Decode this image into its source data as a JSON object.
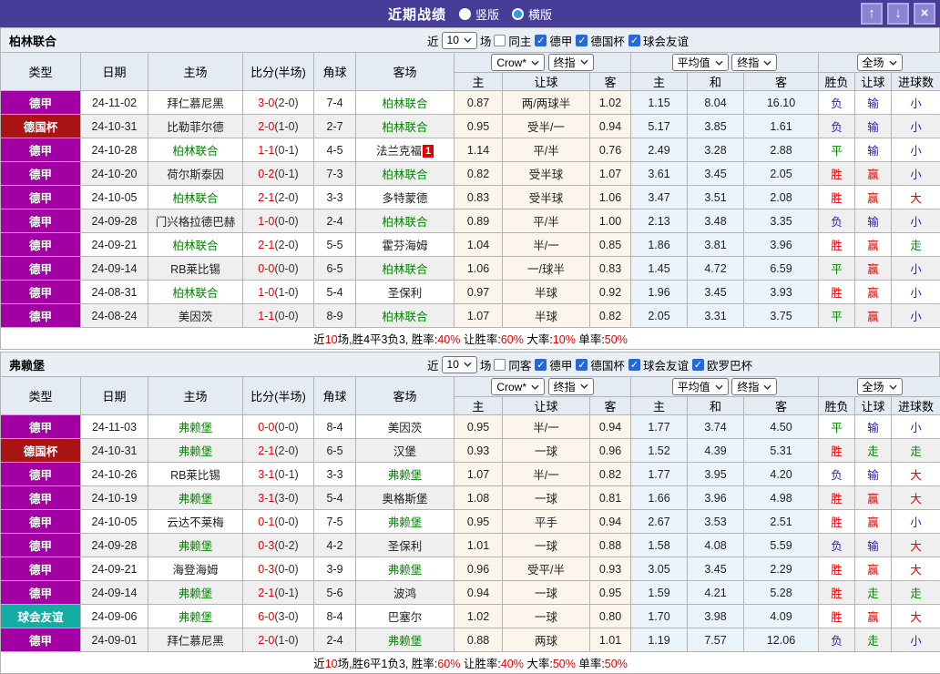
{
  "titlebar": {
    "title": "近期战绩",
    "vertical_label": "竖版",
    "horizontal_label": "横版",
    "selected": "横版",
    "buttons": {
      "up": "↑",
      "down": "↓",
      "close": "×"
    }
  },
  "labels": {
    "near": "近",
    "games": "场"
  },
  "selects": {
    "provider": "Crow*",
    "final1": "终指",
    "average": "平均值",
    "final2": "终指",
    "fulltime": "全场"
  },
  "columns": {
    "type": "类型",
    "date": "日期",
    "home": "主场",
    "score": "比分(半场)",
    "corner": "角球",
    "away": "客场",
    "h_home": "主",
    "h_line": "让球",
    "h_away": "客",
    "a_home": "主",
    "a_draw": "和",
    "a_away": "客",
    "res_wdl": "胜负",
    "res_handicap": "让球",
    "res_goals": "进球数"
  },
  "type_colors": {
    "德甲": "#A300A3",
    "德国杯": "#AA1414",
    "球会友谊": "#16ACA4"
  },
  "result_colors": {
    "win": "#E60000",
    "draw": "#008800",
    "lose": "#2222CC"
  },
  "tables": [
    {
      "team": "柏林联合",
      "filter": {
        "count": "10",
        "checks": [
          {
            "label": "同主",
            "checked": false
          },
          {
            "label": "德甲",
            "checked": true
          },
          {
            "label": "德国杯",
            "checked": true
          },
          {
            "label": "球会友谊",
            "checked": true
          }
        ]
      },
      "rows": [
        {
          "type": "德甲",
          "date": "24-11-02",
          "home": "拜仁慕尼黑",
          "home_green": false,
          "score": "3-0",
          "half": "(2-0)",
          "corners": "7-4",
          "away": "柏林联合",
          "away_green": true,
          "away_badge": "",
          "crow_home": "0.87",
          "crow_line": "两/两球半",
          "crow_away": "1.02",
          "avg_home": "1.15",
          "avg_draw": "8.04",
          "avg_away": "16.10",
          "result": "负",
          "handicap": "输",
          "goals": "小"
        },
        {
          "type": "德国杯",
          "date": "24-10-31",
          "home": "比勒菲尔德",
          "home_green": false,
          "score": "2-0",
          "half": "(1-0)",
          "corners": "2-7",
          "away": "柏林联合",
          "away_green": true,
          "away_badge": "",
          "crow_home": "0.95",
          "crow_line": "受半/一",
          "crow_away": "0.94",
          "avg_home": "5.17",
          "avg_draw": "3.85",
          "avg_away": "1.61",
          "result": "负",
          "handicap": "输",
          "goals": "小"
        },
        {
          "type": "德甲",
          "date": "24-10-28",
          "home": "柏林联合",
          "home_green": true,
          "score": "1-1",
          "half": "(0-1)",
          "corners": "4-5",
          "away": "法兰克福",
          "away_green": false,
          "away_badge": "1",
          "crow_home": "1.14",
          "crow_line": "平/半",
          "crow_away": "0.76",
          "avg_home": "2.49",
          "avg_draw": "3.28",
          "avg_away": "2.88",
          "result": "平",
          "handicap": "输",
          "goals": "小"
        },
        {
          "type": "德甲",
          "date": "24-10-20",
          "home": "荷尔斯泰因",
          "home_green": false,
          "score": "0-2",
          "half": "(0-1)",
          "corners": "7-3",
          "away": "柏林联合",
          "away_green": true,
          "away_badge": "",
          "crow_home": "0.82",
          "crow_line": "受半球",
          "crow_away": "1.07",
          "avg_home": "3.61",
          "avg_draw": "3.45",
          "avg_away": "2.05",
          "result": "胜",
          "handicap": "赢",
          "goals": "小"
        },
        {
          "type": "德甲",
          "date": "24-10-05",
          "home": "柏林联合",
          "home_green": true,
          "score": "2-1",
          "half": "(2-0)",
          "corners": "3-3",
          "away": "多特蒙德",
          "away_green": false,
          "away_badge": "",
          "crow_home": "0.83",
          "crow_line": "受半球",
          "crow_away": "1.06",
          "avg_home": "3.47",
          "avg_draw": "3.51",
          "avg_away": "2.08",
          "result": "胜",
          "handicap": "赢",
          "goals": "大"
        },
        {
          "type": "德甲",
          "date": "24-09-28",
          "home": "门兴格拉德巴赫",
          "home_green": false,
          "score": "1-0",
          "half": "(0-0)",
          "corners": "2-4",
          "away": "柏林联合",
          "away_green": true,
          "away_badge": "",
          "crow_home": "0.89",
          "crow_line": "平/半",
          "crow_away": "1.00",
          "avg_home": "2.13",
          "avg_draw": "3.48",
          "avg_away": "3.35",
          "result": "负",
          "handicap": "输",
          "goals": "小"
        },
        {
          "type": "德甲",
          "date": "24-09-21",
          "home": "柏林联合",
          "home_green": true,
          "score": "2-1",
          "half": "(2-0)",
          "corners": "5-5",
          "away": "霍芬海姆",
          "away_green": false,
          "away_badge": "",
          "crow_home": "1.04",
          "crow_line": "半/一",
          "crow_away": "0.85",
          "avg_home": "1.86",
          "avg_draw": "3.81",
          "avg_away": "3.96",
          "result": "胜",
          "handicap": "赢",
          "goals": "走"
        },
        {
          "type": "德甲",
          "date": "24-09-14",
          "home": "RB莱比锡",
          "home_green": false,
          "score": "0-0",
          "half": "(0-0)",
          "corners": "6-5",
          "away": "柏林联合",
          "away_green": true,
          "away_badge": "",
          "crow_home": "1.06",
          "crow_line": "一/球半",
          "crow_away": "0.83",
          "avg_home": "1.45",
          "avg_draw": "4.72",
          "avg_away": "6.59",
          "result": "平",
          "handicap": "赢",
          "goals": "小"
        },
        {
          "type": "德甲",
          "date": "24-08-31",
          "home": "柏林联合",
          "home_green": true,
          "score": "1-0",
          "half": "(1-0)",
          "corners": "5-4",
          "away": "圣保利",
          "away_green": false,
          "away_badge": "",
          "crow_home": "0.97",
          "crow_line": "半球",
          "crow_away": "0.92",
          "avg_home": "1.96",
          "avg_draw": "3.45",
          "avg_away": "3.93",
          "result": "胜",
          "handicap": "赢",
          "goals": "小"
        },
        {
          "type": "德甲",
          "date": "24-08-24",
          "home": "美因茨",
          "home_green": false,
          "score": "1-1",
          "half": "(0-0)",
          "corners": "8-9",
          "away": "柏林联合",
          "away_green": true,
          "away_badge": "",
          "crow_home": "1.07",
          "crow_line": "半球",
          "crow_away": "0.82",
          "avg_home": "2.05",
          "avg_draw": "3.31",
          "avg_away": "3.75",
          "result": "平",
          "handicap": "赢",
          "goals": "小"
        }
      ],
      "summary": [
        {
          "t": "近",
          "red": false
        },
        {
          "t": "10",
          "red": true
        },
        {
          "t": "场,胜4平3负3, 胜率:",
          "red": false
        },
        {
          "t": "40%",
          "red": true
        },
        {
          "t": " 让胜率:",
          "red": false
        },
        {
          "t": "60%",
          "red": true
        },
        {
          "t": " 大率:",
          "red": false
        },
        {
          "t": "10%",
          "red": true
        },
        {
          "t": " 单率:",
          "red": false
        },
        {
          "t": "50%",
          "red": true
        }
      ]
    },
    {
      "team": "弗赖堡",
      "filter": {
        "count": "10",
        "checks": [
          {
            "label": "同客",
            "checked": false
          },
          {
            "label": "德甲",
            "checked": true
          },
          {
            "label": "德国杯",
            "checked": true
          },
          {
            "label": "球会友谊",
            "checked": true
          },
          {
            "label": "欧罗巴杯",
            "checked": true
          }
        ]
      },
      "rows": [
        {
          "type": "德甲",
          "date": "24-11-03",
          "home": "弗赖堡",
          "home_green": true,
          "score": "0-0",
          "half": "(0-0)",
          "corners": "8-4",
          "away": "美因茨",
          "away_green": false,
          "away_badge": "",
          "crow_home": "0.95",
          "crow_line": "半/一",
          "crow_away": "0.94",
          "avg_home": "1.77",
          "avg_draw": "3.74",
          "avg_away": "4.50",
          "result": "平",
          "handicap": "输",
          "goals": "小"
        },
        {
          "type": "德国杯",
          "date": "24-10-31",
          "home": "弗赖堡",
          "home_green": true,
          "score": "2-1",
          "half": "(2-0)",
          "corners": "6-5",
          "away": "汉堡",
          "away_green": false,
          "away_badge": "",
          "crow_home": "0.93",
          "crow_line": "一球",
          "crow_away": "0.96",
          "avg_home": "1.52",
          "avg_draw": "4.39",
          "avg_away": "5.31",
          "result": "胜",
          "handicap": "走",
          "goals": "走"
        },
        {
          "type": "德甲",
          "date": "24-10-26",
          "home": "RB莱比锡",
          "home_green": false,
          "score": "3-1",
          "half": "(0-1)",
          "corners": "3-3",
          "away": "弗赖堡",
          "away_green": true,
          "away_badge": "",
          "crow_home": "1.07",
          "crow_line": "半/一",
          "crow_away": "0.82",
          "avg_home": "1.77",
          "avg_draw": "3.95",
          "avg_away": "4.20",
          "result": "负",
          "handicap": "输",
          "goals": "大"
        },
        {
          "type": "德甲",
          "date": "24-10-19",
          "home": "弗赖堡",
          "home_green": true,
          "score": "3-1",
          "half": "(3-0)",
          "corners": "5-4",
          "away": "奥格斯堡",
          "away_green": false,
          "away_badge": "",
          "crow_home": "1.08",
          "crow_line": "一球",
          "crow_away": "0.81",
          "avg_home": "1.66",
          "avg_draw": "3.96",
          "avg_away": "4.98",
          "result": "胜",
          "handicap": "赢",
          "goals": "大"
        },
        {
          "type": "德甲",
          "date": "24-10-05",
          "home": "云达不莱梅",
          "home_green": false,
          "score": "0-1",
          "half": "(0-0)",
          "corners": "7-5",
          "away": "弗赖堡",
          "away_green": true,
          "away_badge": "",
          "crow_home": "0.95",
          "crow_line": "平手",
          "crow_away": "0.94",
          "avg_home": "2.67",
          "avg_draw": "3.53",
          "avg_away": "2.51",
          "result": "胜",
          "handicap": "赢",
          "goals": "小"
        },
        {
          "type": "德甲",
          "date": "24-09-28",
          "home": "弗赖堡",
          "home_green": true,
          "score": "0-3",
          "half": "(0-2)",
          "corners": "4-2",
          "away": "圣保利",
          "away_green": false,
          "away_badge": "",
          "crow_home": "1.01",
          "crow_line": "一球",
          "crow_away": "0.88",
          "avg_home": "1.58",
          "avg_draw": "4.08",
          "avg_away": "5.59",
          "result": "负",
          "handicap": "输",
          "goals": "大"
        },
        {
          "type": "德甲",
          "date": "24-09-21",
          "home": "海登海姆",
          "home_green": false,
          "score": "0-3",
          "half": "(0-0)",
          "corners": "3-9",
          "away": "弗赖堡",
          "away_green": true,
          "away_badge": "",
          "crow_home": "0.96",
          "crow_line": "受平/半",
          "crow_away": "0.93",
          "avg_home": "3.05",
          "avg_draw": "3.45",
          "avg_away": "2.29",
          "result": "胜",
          "handicap": "赢",
          "goals": "大"
        },
        {
          "type": "德甲",
          "date": "24-09-14",
          "home": "弗赖堡",
          "home_green": true,
          "score": "2-1",
          "half": "(0-1)",
          "corners": "5-6",
          "away": "波鸿",
          "away_green": false,
          "away_badge": "",
          "crow_home": "0.94",
          "crow_line": "一球",
          "crow_away": "0.95",
          "avg_home": "1.59",
          "avg_draw": "4.21",
          "avg_away": "5.28",
          "result": "胜",
          "handicap": "走",
          "goals": "走"
        },
        {
          "type": "球会友谊",
          "date": "24-09-06",
          "home": "弗赖堡",
          "home_green": true,
          "score": "6-0",
          "half": "(3-0)",
          "corners": "8-4",
          "away": "巴塞尔",
          "away_green": false,
          "away_badge": "",
          "crow_home": "1.02",
          "crow_line": "一球",
          "crow_away": "0.80",
          "avg_home": "1.70",
          "avg_draw": "3.98",
          "avg_away": "4.09",
          "result": "胜",
          "handicap": "赢",
          "goals": "大"
        },
        {
          "type": "德甲",
          "date": "24-09-01",
          "home": "拜仁慕尼黑",
          "home_green": false,
          "score": "2-0",
          "half": "(1-0)",
          "corners": "2-4",
          "away": "弗赖堡",
          "away_green": true,
          "away_badge": "",
          "crow_home": "0.88",
          "crow_line": "两球",
          "crow_away": "1.01",
          "avg_home": "1.19",
          "avg_draw": "7.57",
          "avg_away": "12.06",
          "result": "负",
          "handicap": "走",
          "goals": "小"
        }
      ],
      "summary": [
        {
          "t": "近",
          "red": false
        },
        {
          "t": "10",
          "red": true
        },
        {
          "t": "场,胜6平1负3, 胜率:",
          "red": false
        },
        {
          "t": "60%",
          "red": true
        },
        {
          "t": " 让胜率:",
          "red": false
        },
        {
          "t": "40%",
          "red": true
        },
        {
          "t": " 大率:",
          "red": false
        },
        {
          "t": "50%",
          "red": true
        },
        {
          "t": " 单率:",
          "red": false
        },
        {
          "t": "50%",
          "red": true
        }
      ]
    }
  ]
}
